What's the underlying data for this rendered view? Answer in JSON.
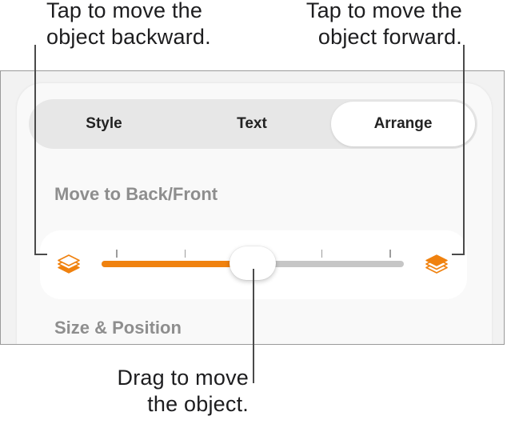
{
  "callouts": {
    "back": "Tap to move the\nobject backward.",
    "forward": "Tap to move the\nobject forward.",
    "drag": "Drag to move\nthe object."
  },
  "tabs": [
    {
      "label": "Style",
      "selected": false
    },
    {
      "label": "Text",
      "selected": false
    },
    {
      "label": "Arrange",
      "selected": true
    }
  ],
  "sections": {
    "move": "Move to Back/Front",
    "size": "Size & Position"
  },
  "slider": {
    "value": 0.5,
    "tick_count": 5,
    "back_icon": "layers-back-icon",
    "front_icon": "layers-front-icon"
  },
  "colors": {
    "accent": "#F0820F",
    "track": "#C6C6C6",
    "panel": "#F2F2F2"
  }
}
